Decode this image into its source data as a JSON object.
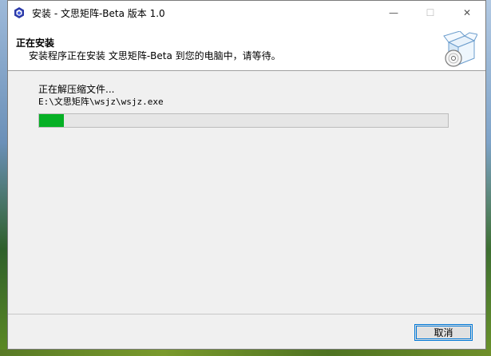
{
  "window": {
    "title": "安装 - 文思矩阵-Beta 版本 1.0",
    "controls": {
      "minimize": "—",
      "maximize": "☐",
      "close": "✕"
    }
  },
  "header": {
    "title": "正在安装",
    "subtitle": "安装程序正在安装 文思矩阵-Beta 到您的电脑中，请等待。"
  },
  "body": {
    "status": "正在解压缩文件...",
    "file_path": "E:\\文思矩阵\\wsjz\\wsjz.exe",
    "progress_percent": 6
  },
  "footer": {
    "cancel_label": "取消"
  },
  "colors": {
    "progress_fill": "#06b025",
    "accent_border": "#0078d7"
  },
  "icons": {
    "app": "app-logo-icon",
    "header": "box-cd-icon"
  }
}
